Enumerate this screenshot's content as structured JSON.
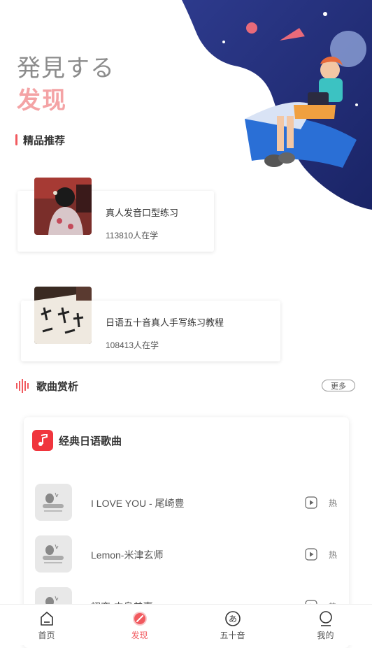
{
  "header": {
    "title_jp": "発見する",
    "title_cn": "发现"
  },
  "featured": {
    "section_title": "精品推荐",
    "courses": [
      {
        "name": "真人发音口型练习",
        "learners": "113810人在学"
      },
      {
        "name": "日语五十音真人手写练习教程",
        "learners": "108413人在学"
      }
    ]
  },
  "songs": {
    "section_title": "歌曲赏析",
    "more_label": "更多",
    "playlist_title": "经典日语歌曲",
    "items": [
      {
        "name": "I LOVE YOU - 尾崎豊",
        "tag": "热"
      },
      {
        "name": "Lemon-米津玄师",
        "tag": "热"
      },
      {
        "name": "初恋-中岛美嘉",
        "tag": "热"
      }
    ]
  },
  "tabbar": {
    "tabs": [
      {
        "label": "首页",
        "icon": "home-icon"
      },
      {
        "label": "发现",
        "icon": "compass-icon",
        "active": true
      },
      {
        "label": "五十音",
        "icon": "kana-icon"
      },
      {
        "label": "我的",
        "icon": "profile-icon"
      }
    ]
  },
  "colors": {
    "accent": "#f15a5f",
    "title_cn": "#f4a3a5",
    "music_icon_bg": "#f0353d"
  }
}
